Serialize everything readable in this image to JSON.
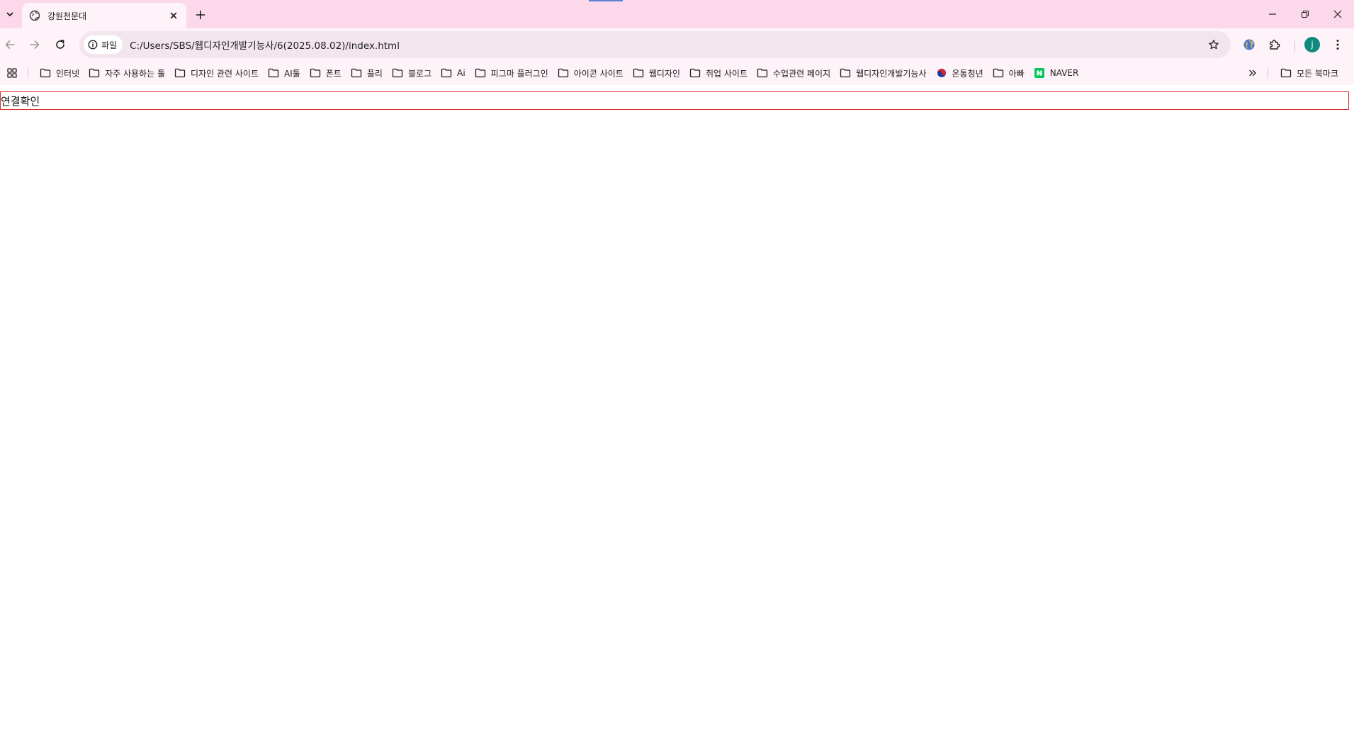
{
  "browser": {
    "tab": {
      "title": "강원천문대",
      "favicon": "globe-icon"
    },
    "window_controls": [
      "minimize-icon",
      "restore-icon",
      "close-icon"
    ],
    "omnibox": {
      "chip_label": "파일",
      "url": "C:/Users/SBS/웹디자인개발기능사/6(2025.08.02)/index.html"
    },
    "profile_initial": "j"
  },
  "bookmarks": {
    "items": [
      {
        "label": "인터넷",
        "icon": "folder-icon"
      },
      {
        "label": "자주 사용하는 툴",
        "icon": "folder-icon"
      },
      {
        "label": "디자인 관련 사이트",
        "icon": "folder-icon"
      },
      {
        "label": "AI툴",
        "icon": "folder-icon"
      },
      {
        "label": "폰트",
        "icon": "folder-icon"
      },
      {
        "label": "플리",
        "icon": "folder-icon"
      },
      {
        "label": "블로그",
        "icon": "folder-icon"
      },
      {
        "label": "Ai",
        "icon": "folder-icon"
      },
      {
        "label": "피그마 플러그인",
        "icon": "folder-icon"
      },
      {
        "label": "아이콘 사이트",
        "icon": "folder-icon"
      },
      {
        "label": "웹디자인",
        "icon": "folder-icon"
      },
      {
        "label": "취업 사이트",
        "icon": "folder-icon"
      },
      {
        "label": "수업관련 페이지",
        "icon": "folder-icon"
      },
      {
        "label": "웹디자인개발기능사",
        "icon": "folder-icon"
      },
      {
        "label": "온통청년",
        "icon": "taegeuk-icon"
      },
      {
        "label": "아빠",
        "icon": "folder-icon"
      },
      {
        "label": "NAVER",
        "icon": "naver-icon"
      }
    ],
    "all_bookmarks_label": "모든 북마크"
  },
  "page": {
    "text": "연결확인"
  },
  "colors": {
    "titlebar": "#fbd9ea",
    "toolbar": "#fdf3f8",
    "omnibox": "#f2e5ee",
    "content_border": "#e12c2c",
    "avatar": "#0e8a7e",
    "naver_green": "#03c75a"
  }
}
